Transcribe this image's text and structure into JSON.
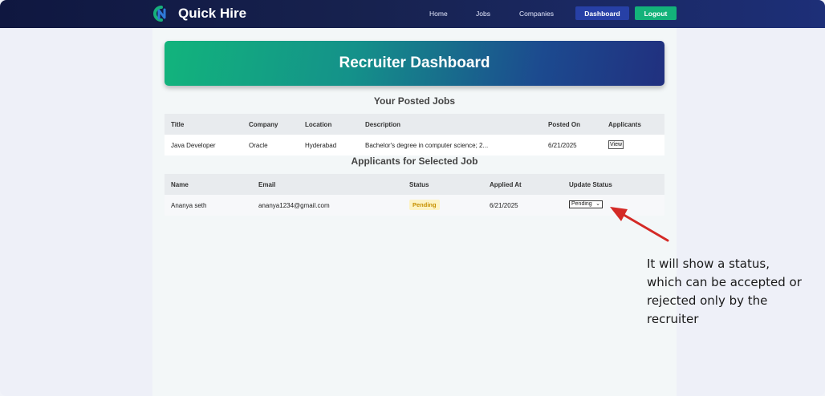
{
  "nav": {
    "brand": "Quick Hire",
    "links": [
      "Home",
      "Jobs",
      "Companies"
    ],
    "dashboard_label": "Dashboard",
    "logout_label": "Logout"
  },
  "hero": {
    "title": "Recruiter Dashboard"
  },
  "posted_jobs": {
    "title": "Your Posted Jobs",
    "headers": [
      "Title",
      "Company",
      "Location",
      "Description",
      "Posted On",
      "Applicants"
    ],
    "rows": [
      {
        "title": "Java Developer",
        "company": "Oracle",
        "location": "Hyderabad",
        "description": "Bachelor's degree in computer science; 2...",
        "posted_on": "6/21/2025",
        "applicants_label": "View"
      }
    ]
  },
  "applicants": {
    "title": "Applicants for Selected Job",
    "headers": [
      "Name",
      "Email",
      "Status",
      "Applied At",
      "Update Status"
    ],
    "rows": [
      {
        "name": "Ananya seth",
        "email": "ananya1234@gmail.com",
        "status": "Pending",
        "applied_at": "6/21/2025",
        "update_status": "Pending"
      }
    ]
  },
  "annotation": {
    "text": "It will show a status, which can be accepted or rejected only  by the recruiter"
  },
  "colors": {
    "nav_bg": "#17224f",
    "dashboard_btn": "#2740a6",
    "logout_btn": "#13b27a",
    "hero_start": "#12b47c",
    "hero_end": "#21307f",
    "pending_badge": "#fdf3c4",
    "arrow": "#d42a26"
  }
}
